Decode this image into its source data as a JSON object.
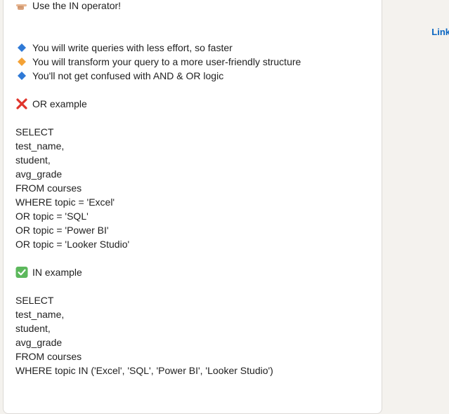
{
  "post": {
    "intro": "Use the IN operator!",
    "benefits": [
      "You will write queries with less effort, so faster",
      "You will transform your query to a more user-friendly structure",
      "You'll not get confused with AND & OR logic"
    ],
    "or_heading": "OR example",
    "or_query": [
      "SELECT",
      "test_name,",
      "student,",
      "avg_grade",
      "FROM courses",
      "WHERE topic = 'Excel'",
      "OR topic = 'SQL'",
      "OR topic = 'Power BI'",
      "OR topic = 'Looker Studio'"
    ],
    "in_heading": "IN example",
    "in_query": [
      "SELECT",
      "test_name,",
      "student,",
      "avg_grade",
      "FROM courses",
      "WHERE topic IN ('Excel', 'SQL', 'Power BI', 'Looker Studio')"
    ]
  },
  "sidebar": {
    "link_label": "Link"
  },
  "icons": {
    "intro": "pointing-hand-icon",
    "benefit_1": "blue-diamond-icon",
    "benefit_2": "orange-diamond-icon",
    "benefit_3": "blue-diamond-icon",
    "or_heading": "red-cross-icon",
    "in_heading": "green-check-icon"
  },
  "colors": {
    "background": "#f4f2ee",
    "card": "#ffffff",
    "link": "#0a66c2",
    "blue_diamond": "#2f79d6",
    "orange_diamond": "#f4a236",
    "red_cross": "#e0342b",
    "green_check": "#5cb85c"
  }
}
